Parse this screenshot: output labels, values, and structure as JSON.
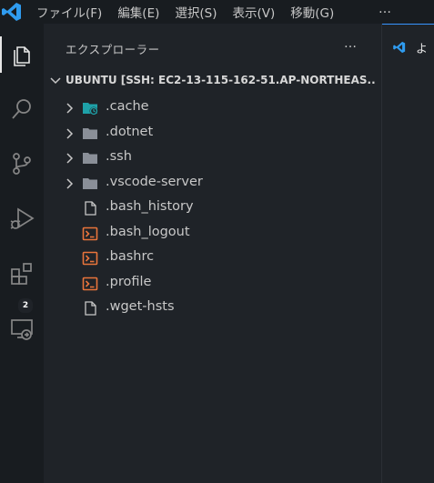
{
  "menubar": {
    "items": [
      "ファイル(F)",
      "編集(E)",
      "選択(S)",
      "表示(V)",
      "移動(G)"
    ],
    "more": "…"
  },
  "activity": {
    "extensions_badge": "2"
  },
  "sidebar": {
    "title": "エクスプローラー",
    "actions": "…",
    "root_label": "UBUNTU [SSH: EC2-13-115-162-51.AP-NORTHEAS...",
    "items": [
      {
        "name": ".cache",
        "type": "folder"
      },
      {
        "name": ".dotnet",
        "type": "folder"
      },
      {
        "name": ".ssh",
        "type": "folder"
      },
      {
        "name": ".vscode-server",
        "type": "folder"
      },
      {
        "name": ".bash_history",
        "type": "file"
      },
      {
        "name": ".bash_logout",
        "type": "shell"
      },
      {
        "name": ".bashrc",
        "type": "shell"
      },
      {
        "name": ".profile",
        "type": "shell"
      },
      {
        "name": ".wget-hsts",
        "type": "file"
      }
    ]
  },
  "editor": {
    "tab_label": "よ"
  },
  "colors": {
    "accent": "#3794ff",
    "vscode_blue": "#2f9cf0",
    "shell_orange": "#e8743b",
    "cache_teal": "#1ea1a8"
  }
}
